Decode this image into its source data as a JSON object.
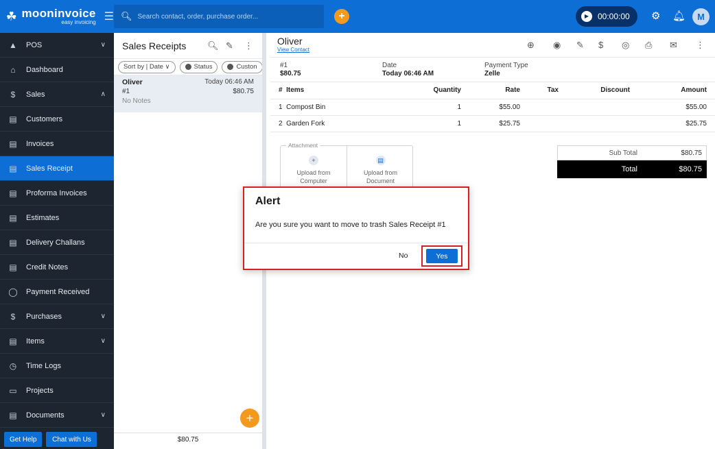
{
  "brand": {
    "name": "mooninvoice",
    "tagline": "easy invoicing"
  },
  "search": {
    "placeholder": "Search contact, order, purchase order..."
  },
  "timer": {
    "value": "00:00:00"
  },
  "user": {
    "initial": "M"
  },
  "sidebar": {
    "items": [
      {
        "label": "POS",
        "chevron": "∨"
      },
      {
        "label": "Dashboard"
      },
      {
        "label": "Sales",
        "chevron": "∧"
      },
      {
        "label": "Customers"
      },
      {
        "label": "Invoices"
      },
      {
        "label": "Sales Receipt"
      },
      {
        "label": "Proforma Invoices"
      },
      {
        "label": "Estimates"
      },
      {
        "label": "Delivery Challans"
      },
      {
        "label": "Credit Notes"
      },
      {
        "label": "Payment Received"
      },
      {
        "label": "Purchases",
        "chevron": "∨"
      },
      {
        "label": "Items",
        "chevron": "∨"
      },
      {
        "label": "Time Logs"
      },
      {
        "label": "Projects"
      },
      {
        "label": "Documents",
        "chevron": "∨"
      }
    ],
    "help_label": "Get Help",
    "chat_label": "Chat with Us"
  },
  "list": {
    "title": "Sales Receipts",
    "filters": {
      "sort": "Sort by | Date ∨",
      "status": "Status",
      "customer": "Custon"
    },
    "rows": [
      {
        "name": "Oliver",
        "date": "Today 06:46 AM",
        "number": "#1",
        "amount": "$80.75",
        "notes": "No Notes"
      }
    ],
    "footer_total": "$80.75"
  },
  "detail": {
    "customer": "Oliver",
    "view_contact": "View Contact",
    "meta": {
      "number": "#1",
      "amount": "$80.75",
      "date_label": "Date",
      "date_value": "Today 06:46 AM",
      "payment_label": "Payment Type",
      "payment_value": "Zelle"
    },
    "columns": {
      "num": "#",
      "items": "Items",
      "quantity": "Quantity",
      "rate": "Rate",
      "tax": "Tax",
      "discount": "Discount",
      "amount": "Amount"
    },
    "items": [
      {
        "num": "1",
        "name": "Compost Bin",
        "quantity": "1",
        "rate": "$55.00",
        "tax": "",
        "discount": "",
        "amount": "$55.00"
      },
      {
        "num": "2",
        "name": "Garden Fork",
        "quantity": "1",
        "rate": "$25.75",
        "tax": "",
        "discount": "",
        "amount": "$25.75"
      }
    ],
    "attachment": {
      "legend": "Attachment",
      "computer_line1": "Upload from",
      "computer_line2": "Computer",
      "document_line1": "Upload from",
      "document_line2": "Document"
    },
    "totals": {
      "subtotal_label": "Sub Total",
      "subtotal": "$80.75",
      "total_label": "Total",
      "total": "$80.75"
    }
  },
  "alert": {
    "title": "Alert",
    "message": "Are you sure you want to move to trash Sales Receipt #1",
    "no_label": "No",
    "yes_label": "Yes"
  }
}
